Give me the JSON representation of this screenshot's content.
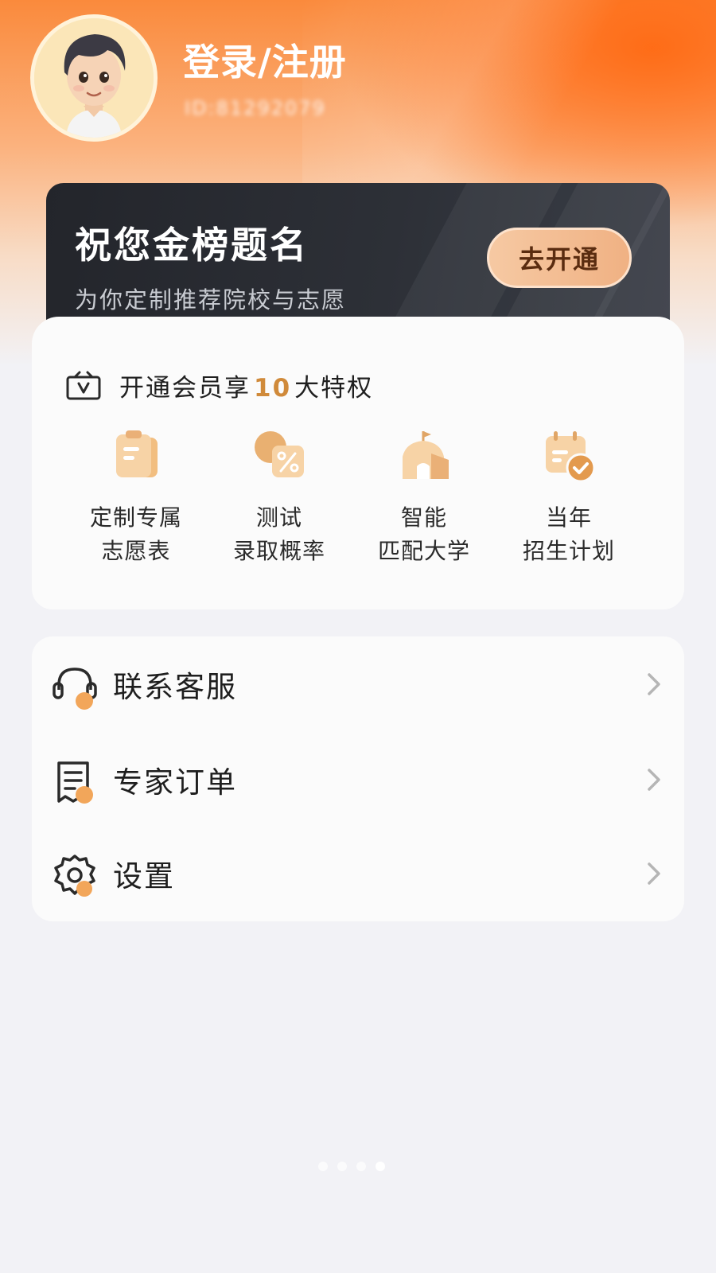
{
  "header": {
    "login_title": "登录/注册",
    "user_id": "ID:81292079"
  },
  "vip_banner": {
    "title": "祝您金榜题名",
    "subtitle": "为你定制推荐院校与志愿",
    "open_button": "去开通"
  },
  "privileges": {
    "prefix": "开通会员享",
    "count": "10",
    "suffix": "大特权",
    "items": [
      {
        "line1": "定制专属",
        "line2": "志愿表",
        "icon": "clipboard-icon"
      },
      {
        "line1": "测试",
        "line2": "录取概率",
        "icon": "percent-icon"
      },
      {
        "line1": "智能",
        "line2": "匹配大学",
        "icon": "school-icon"
      },
      {
        "line1": "当年",
        "line2": "招生计划",
        "icon": "calendar-check-icon"
      }
    ]
  },
  "menu": {
    "items": [
      {
        "label": "联系客服",
        "icon": "headset-icon"
      },
      {
        "label": "专家订单",
        "icon": "receipt-icon"
      },
      {
        "label": "设置",
        "icon": "gear-icon"
      }
    ]
  },
  "colors": {
    "accent_orange": "#ff6a14",
    "gold": "#d08a3a",
    "banner_dark": "#2d3037",
    "button_peach": "#f6c9a3",
    "page_bg": "#f2f2f6"
  }
}
